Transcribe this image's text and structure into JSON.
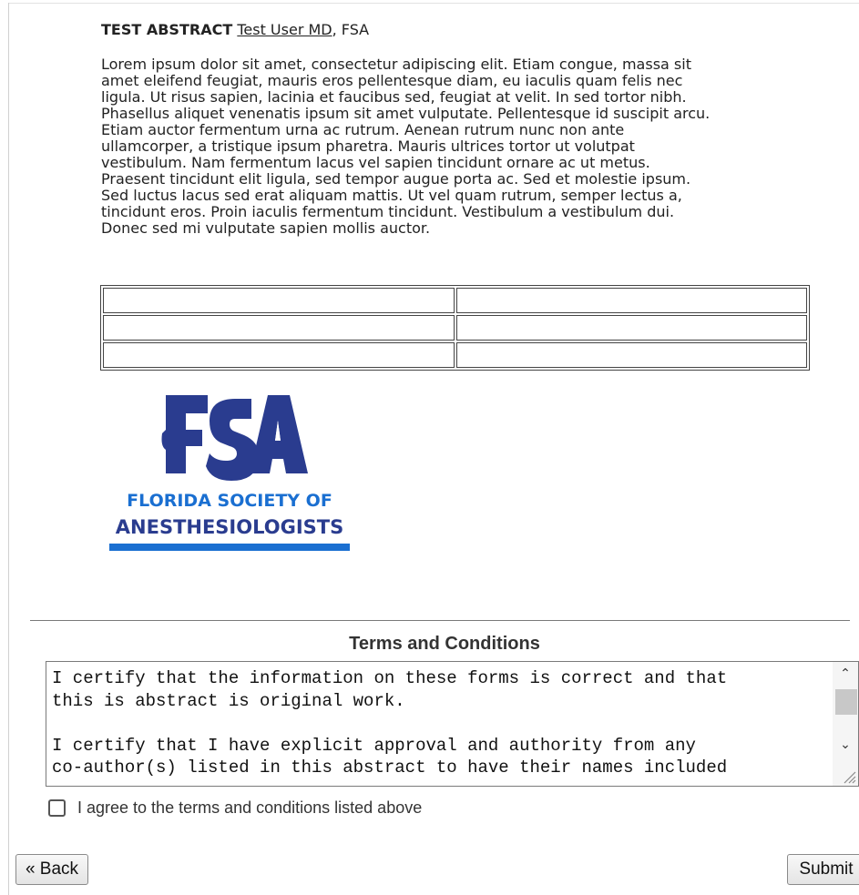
{
  "abstract": {
    "title": "TEST ABSTRACT",
    "author_link": "Test User MD",
    "affiliation": ", FSA",
    "body_lines": [
      "Lorem ipsum dolor sit amet, consectetur adipiscing elit. Etiam congue, massa sit",
      "amet eleifend feugiat, mauris eros pellentesque diam, eu iaculis quam felis nec",
      "ligula. Ut risus sapien, lacinia et faucibus sed, feugiat at velit. In sed tortor nibh.",
      "Phasellus aliquet venenatis ipsum sit amet vulputate. Pellentesque id suscipit arcu.",
      "Etiam auctor fermentum urna ac rutrum. Aenean rutrum nunc non ante",
      "ullamcorper, a tristique ipsum pharetra. Mauris ultrices tortor ut volutpat",
      "vestibulum. Nam fermentum lacus vel sapien tincidunt ornare ac ut metus.",
      "Praesent tincidunt elit ligula, sed tempor augue porta ac. Sed et molestie ipsum.",
      "Sed luctus lacus sed erat aliquam mattis. Ut vel quam rutrum, semper lectus a,",
      "tincidunt eros. Proin iaculis fermentum tincidunt. Vestibulum a vestibulum dui.",
      "Donec sed mi vulputate sapien mollis auctor."
    ]
  },
  "logo": {
    "mark": "FSA",
    "line1": "FLORIDA SOCIETY OF",
    "line2": "ANESTHESIOLOGISTS",
    "brand_color": "#2a3c8f",
    "accent_color": "#1a6fd1"
  },
  "terms": {
    "heading": "Terms and Conditions",
    "text": "I certify that the information on these forms is correct and that\nthis is abstract is original work.\n\nI certify that I have explicit approval and authority from any\nco-author(s) listed in this abstract to have their names included"
  },
  "agree_label": "I agree to the terms and conditions listed above",
  "buttons": {
    "back": "« Back",
    "submit": "Submit"
  }
}
